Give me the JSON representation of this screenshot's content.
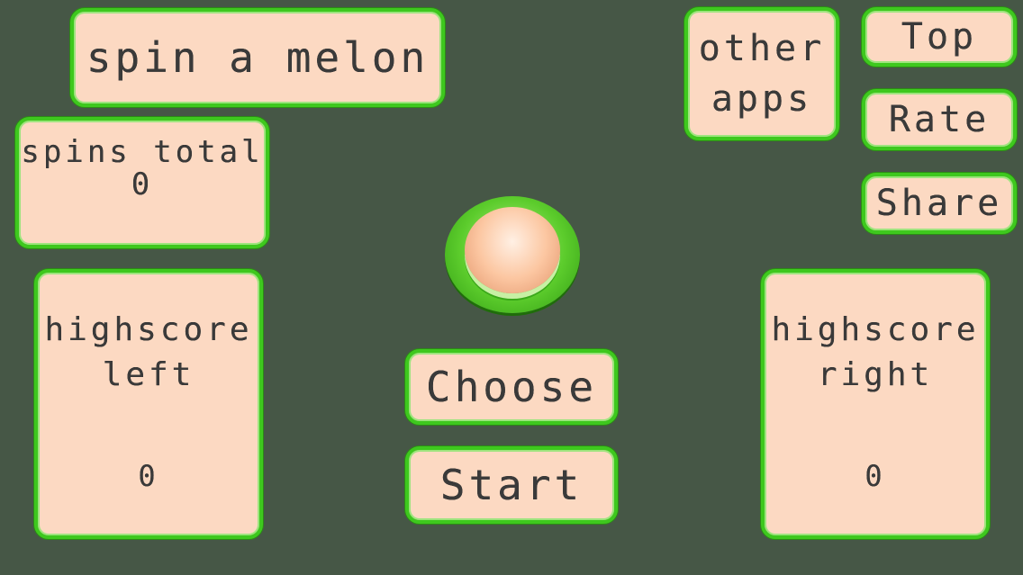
{
  "title": "spin a melon",
  "spins": {
    "label": "spins total",
    "value": "0"
  },
  "highscore_left": {
    "label_line1": "highscore",
    "label_line2": "left",
    "value": "0"
  },
  "highscore_right": {
    "label_line1": "highscore",
    "label_line2": "right",
    "value": "0"
  },
  "menu": {
    "other_apps_line1": "other",
    "other_apps_line2": "apps",
    "top": "Top",
    "rate": "Rate",
    "share": "Share"
  },
  "controls": {
    "choose": "Choose",
    "start": "Start"
  },
  "colors": {
    "background": "#465746",
    "panel": "#fcd9c2",
    "border": "#3ec81e"
  }
}
